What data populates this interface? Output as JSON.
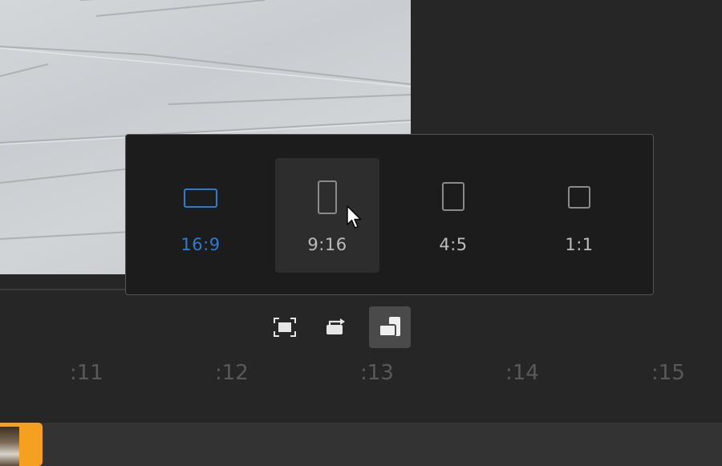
{
  "aspect_ratio_menu": {
    "options": [
      {
        "label": "16:9",
        "state": "active",
        "icon": "landscape-rect-icon"
      },
      {
        "label": "9:16",
        "state": "hover",
        "icon": "portrait-rect-icon"
      },
      {
        "label": "4:5",
        "state": "normal",
        "icon": "portrait-square-icon"
      },
      {
        "label": "1:1",
        "state": "normal",
        "icon": "square-icon"
      }
    ]
  },
  "toolbar": {
    "buttons": [
      {
        "name": "fit-frame",
        "icon": "frame-fit-icon",
        "selected": false
      },
      {
        "name": "rotate",
        "icon": "rotate-icon",
        "selected": false
      },
      {
        "name": "aspect-ratio",
        "icon": "aspect-ratio-icon",
        "selected": true
      }
    ]
  },
  "timeline": {
    "ticks": [
      ":11",
      ":12",
      ":13",
      ":14",
      ":15"
    ]
  },
  "colors": {
    "accent": "#2a7bd6",
    "clip": "#f5a021",
    "background": "#262626"
  }
}
